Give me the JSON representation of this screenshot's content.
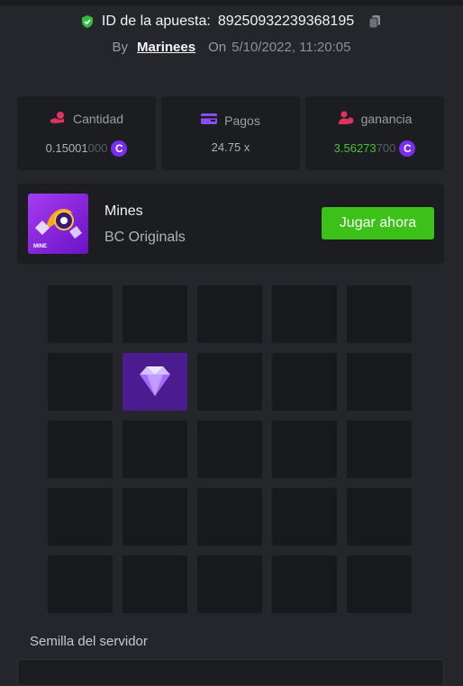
{
  "header": {
    "bet_id_label": "ID de la apuesta:",
    "bet_id": "89250932239368195",
    "by_label": "By",
    "user": "Marinees",
    "on_label": "On",
    "date": "5/10/2022, 11:20:05"
  },
  "stats": {
    "amount": {
      "label": "Cantidad",
      "value_main": "0.15001",
      "value_dim": "000",
      "icon": "hand-coins-icon"
    },
    "payout": {
      "label": "Pagos",
      "value": "24.75 x",
      "icon": "wallet-icon"
    },
    "profit": {
      "label": "ganancia",
      "value_main": "3.56273",
      "value_dim": "700",
      "icon": "user-coin-icon"
    },
    "currency_symbol": "C"
  },
  "game": {
    "name": "Mines",
    "provider": "BC Originals",
    "thumb_label": "MINE",
    "play_label": "Jugar ahora"
  },
  "board": {
    "rows": 5,
    "cols": 5,
    "revealed_gem": {
      "row": 2,
      "col": 2
    }
  },
  "seed": {
    "label": "Semilla del servidor"
  },
  "colors": {
    "accent_green": "#3bc117",
    "profit_green": "#43c530",
    "coin_purple": "#7b2cf0",
    "gem_tile": "#4a1c8f"
  }
}
